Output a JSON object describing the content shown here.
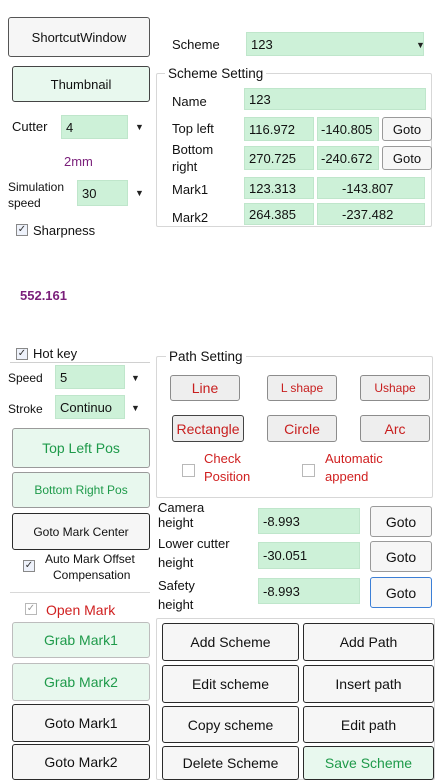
{
  "left": {
    "shortcut_window": "ShortcutWindow",
    "thumbnail": "Thumbnail",
    "cutter_label": "Cutter",
    "cutter_value": "4",
    "cutter_size": "2mm",
    "sim_speed_label_1": "Simulation",
    "sim_speed_label_2": "speed",
    "sim_speed_value": "30",
    "sharpness_label": "Sharpness",
    "sharpness_checked": true,
    "sharpness_value": "552.161"
  },
  "scheme": {
    "label": "Scheme",
    "value": "123"
  },
  "scheme_setting": {
    "title": "Scheme Setting",
    "name_label": "Name",
    "name_value": "123",
    "top_left_label": "Top left",
    "top_left_x": "116.972",
    "top_left_y": "-140.805",
    "bottom_right_label_1": "Bottom",
    "bottom_right_label_2": "right",
    "bottom_right_x": "270.725",
    "bottom_right_y": "-240.672",
    "mark1_label": "Mark1",
    "mark1_x": "123.313",
    "mark1_y": "-143.807",
    "mark2_label": "Mark2",
    "mark2_x": "264.385",
    "mark2_y": "-237.482",
    "goto": "Goto"
  },
  "hotkey": {
    "label": "Hot key",
    "checked": true,
    "speed_label": "Speed",
    "speed_value": "5",
    "stroke_label": "Stroke",
    "stroke_value": "Continuo"
  },
  "path_setting": {
    "title": "Path Setting",
    "line": "Line",
    "l_shape": "L shape",
    "u_shape": "Ushape",
    "rectangle": "Rectangle",
    "circle": "Circle",
    "arc": "Arc",
    "check_position_1": "Check",
    "check_position_2": "Position",
    "automatic_append_1": "Automatic",
    "automatic_append_2": "append"
  },
  "positions": {
    "top_left_pos": "Top Left Pos",
    "bottom_right_pos": "Bottom Right Pos",
    "goto_mark_center": "Goto Mark Center",
    "auto_mark_offset_1": "Auto Mark Offset",
    "auto_mark_offset_2": "Compensation",
    "auto_mark_checked": true,
    "open_mark": "Open Mark",
    "open_mark_checked": true,
    "grab_mark1": "Grab Mark1",
    "grab_mark2": "Grab Mark2",
    "goto_mark1": "Goto Mark1",
    "goto_mark2": "Goto Mark2"
  },
  "heights": {
    "camera_1": "Camera",
    "camera_2": "height",
    "camera_value": "-8.993",
    "lower_cutter_1": "Lower cutter",
    "lower_cutter_2": "height",
    "lower_cutter_value": "-30.051",
    "safety_1": "Safety",
    "safety_2": "height",
    "safety_value": "-8.993",
    "goto": "Goto"
  },
  "actions": {
    "add_scheme": "Add Scheme",
    "add_path": "Add Path",
    "edit_scheme": "Edit scheme",
    "insert_path": "Insert path",
    "copy_scheme": "Copy scheme",
    "edit_path": "Edit path",
    "delete_scheme": "Delete Scheme",
    "save_scheme": "Save Scheme"
  },
  "colors": {
    "field_green": "#cdf1d8",
    "green_text": "#1e9a4a",
    "red_text": "#d02020",
    "purple_text": "#7a1f7a"
  }
}
